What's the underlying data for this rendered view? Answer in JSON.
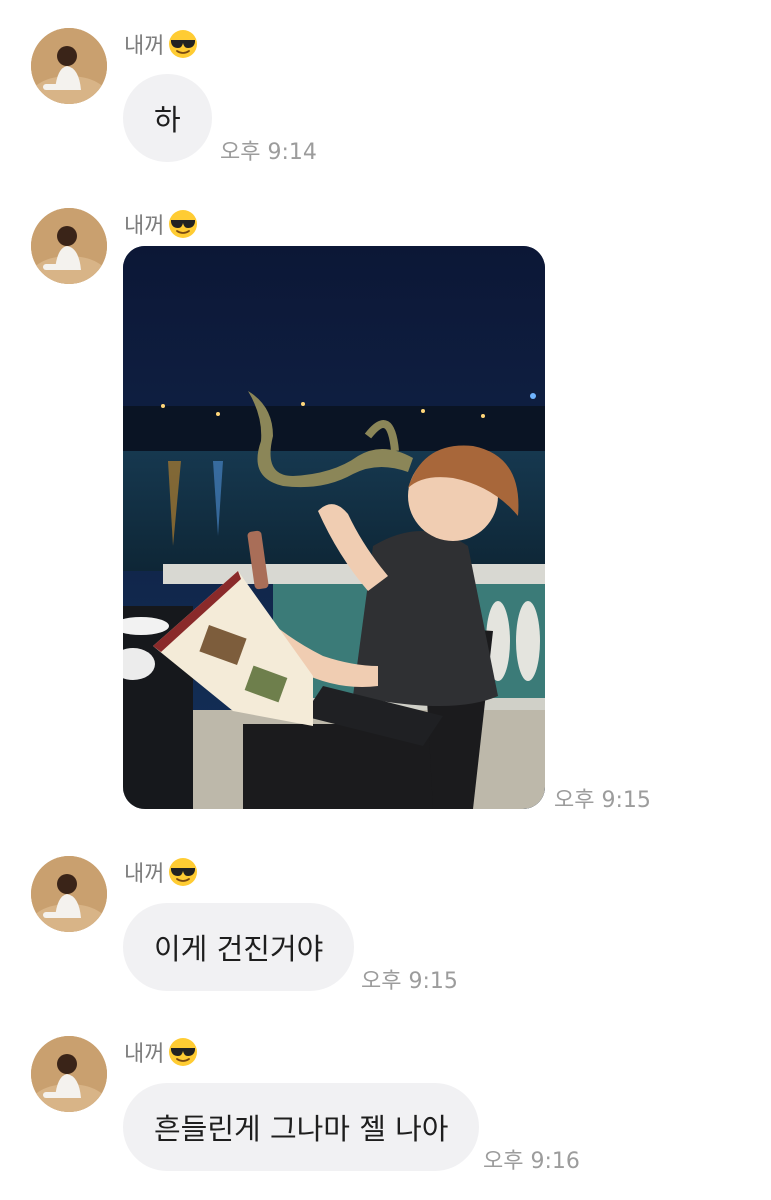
{
  "messages": [
    {
      "sender": "내꺼",
      "emoji": "sunglasses-emoji",
      "type": "text",
      "text": "하",
      "time": "오후 9:14"
    },
    {
      "sender": "내꺼",
      "emoji": "sunglasses-emoji",
      "type": "photo",
      "time": "오후 9:15"
    },
    {
      "sender": "내꺼",
      "emoji": "sunglasses-emoji",
      "type": "text",
      "text": "이게 건진거야",
      "time": "오후 9:15"
    },
    {
      "sender": "내꺼",
      "emoji": "sunglasses-emoji",
      "type": "text",
      "text": "흔들린게 그나마 젤 나아",
      "time": "오후 9:16"
    }
  ],
  "colors": {
    "bubble": "#f1f1f3",
    "sender": "#7d7d7d",
    "time": "#9c9c9c",
    "text": "#1e1e1e"
  }
}
